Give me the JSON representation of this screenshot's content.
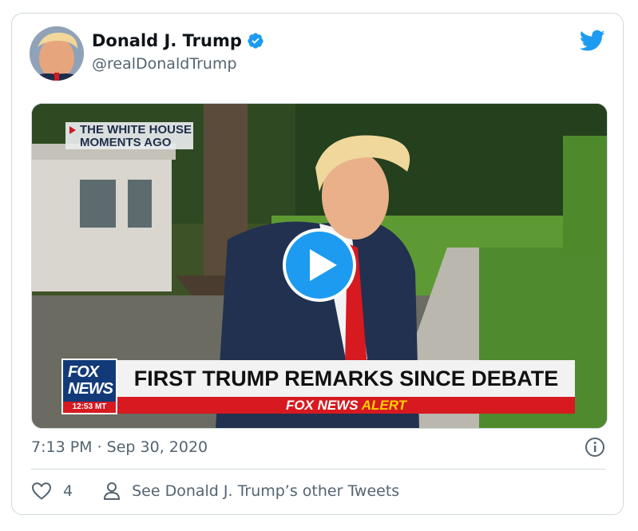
{
  "tweet": {
    "author": {
      "display_name": "Donald J. Trump",
      "handle": "@realDonaldTrump",
      "verified": true
    },
    "timestamp": "7:13 PM · Sep 30, 2020",
    "likes": "4",
    "other_tweets_label": "See Donald J. Trump’s other Tweets"
  },
  "video": {
    "tag_line1": "THE WHITE HOUSE",
    "tag_line2": "MOMENTS AGO",
    "logo_line1": "FOX",
    "logo_line2": "NEWS",
    "logo_time": "12:53 MT",
    "headline": "FIRST TRUMP REMARKS SINCE DEBATE",
    "alert_part1": "FOX NEWS",
    "alert_part2": " ALERT"
  },
  "colors": {
    "accent": "#1d9bf0",
    "secondary_text": "#536471",
    "border": "#cfd9de",
    "fox_red": "#d71920",
    "fox_blue": "#123a78"
  },
  "icons": {
    "verified": "verified-badge-icon",
    "brand": "twitter-bird-icon",
    "play": "play-icon",
    "info": "info-icon",
    "like": "heart-icon",
    "profile": "person-icon"
  }
}
